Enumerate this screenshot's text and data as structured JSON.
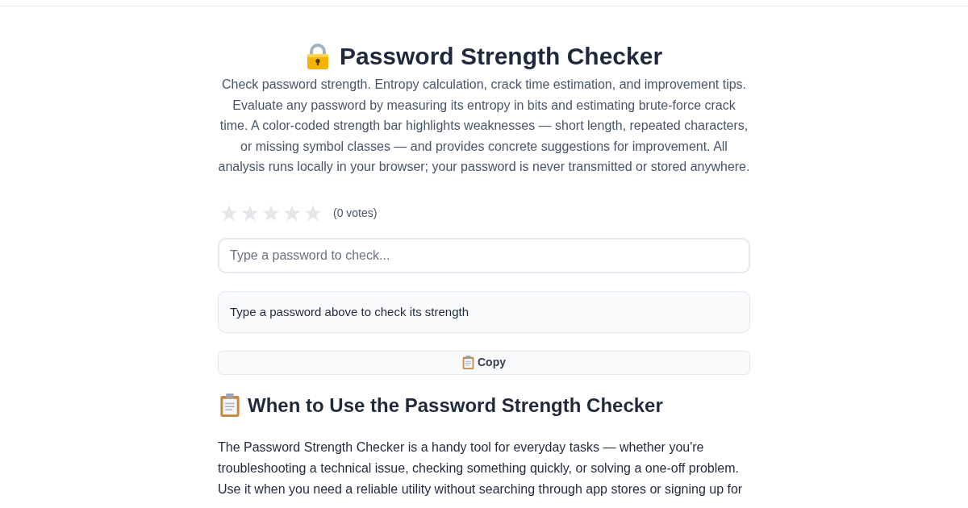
{
  "title": "Password Strength Checker",
  "description": "Check password strength. Entropy calculation, crack time estimation, and improvement tips. Evaluate any password by measuring its entropy in bits and estimating brute-force crack time. A color-coded strength bar highlights weaknesses — short length, repeated characters, or missing symbol classes — and provides concrete suggestions for improvement. All analysis runs locally in your browser; your password is never transmitted or stored anywhere.",
  "rating": {
    "stars": 0,
    "votes": "(0 votes)"
  },
  "password_field": {
    "placeholder": "Type a password to check..."
  },
  "result": {
    "message": "Type a password above to check its strength"
  },
  "copy_button": {
    "label": "Copy"
  },
  "section": {
    "heading": "When to Use the Password Strength Checker",
    "paragraph": "The Password Strength Checker is a handy tool for everyday tasks — whether you're troubleshooting a technical issue, checking something quickly, or solving a one-off problem. Use it when you need a reliable utility without searching through app stores or signing up for"
  }
}
